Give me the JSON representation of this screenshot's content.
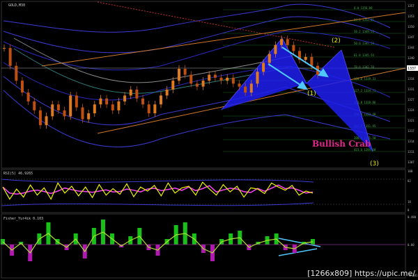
{
  "window": {
    "main_title": "GOLD,M30",
    "rsi_title": "RSI(5) 46.9265",
    "fisher_title": "Fisher_Yur4ik 0.103",
    "watermark": "[1266x809] https://upic.me/"
  },
  "pattern": {
    "label": "Bullish Crab",
    "wave_1": "(1)",
    "wave_2": "(2)",
    "wave_3": "(3)",
    "price_tag": "1337"
  },
  "price_axis": [
    "1357",
    "1353",
    "1350",
    "1347",
    "1344",
    "1340",
    "1337",
    "1334",
    "1331",
    "1327",
    "1324",
    "1321",
    "1317",
    "1314",
    "1311",
    "1307"
  ],
  "rsi_axis": [
    "100",
    "82",
    "18",
    "0"
  ],
  "fisher_axis": [
    "0.480",
    "0.00",
    "-0.481"
  ],
  "fib_levels": [
    "0.0 1356.00",
    "23.6 1352.01",
    "38.2 1349.53",
    "50.0 1347.54",
    "61.8 1345.54",
    "78.6 1342.70",
    "100.0 1339.31",
    "127.2 1334.71",
    "161.8 1328.86",
    "200.0 1322.40",
    "261.8 1311.95",
    "300.0 1305.50",
    "423.6 1284.60"
  ],
  "colors": {
    "background": "#000000",
    "candle_up": "#e07a1f",
    "candle_down": "#c05010",
    "envelope": "#3b3bd6",
    "pattern_fill": "#1f1ff0",
    "fib_lines": "#1d6b1d",
    "rsi_line": "#f2f200",
    "rsi_signal": "#ff40ff",
    "fisher_pos": "#19c019",
    "fisher_neg": "#b019b0",
    "arrow": "#4fc8ff",
    "label_pink": "#e0288a",
    "wave_yellow": "#ecec00"
  },
  "chart_data": {
    "type": "line",
    "title": "GOLD,M30",
    "series": [
      {
        "name": "GOLD,M30",
        "values": [
          1345,
          1339,
          1334,
          1330,
          1327,
          1324,
          1319,
          1322,
          1326,
          1324,
          1322,
          1329,
          1325,
          1321,
          1323,
          1326,
          1328,
          1326,
          1324,
          1327,
          1329,
          1331,
          1328,
          1326,
          1323,
          1326,
          1329,
          1331,
          1334,
          1338,
          1336,
          1333,
          1332,
          1334,
          1336,
          1335,
          1334,
          1335,
          1333,
          1332,
          1330,
          1333,
          1337,
          1340,
          1343,
          1346,
          1348,
          1346,
          1344,
          1341,
          1342,
          1339,
          1336
        ]
      },
      {
        "name": "RSI(5)",
        "values": [
          60,
          30,
          55,
          35,
          65,
          40,
          58,
          30,
          70,
          45,
          62,
          38,
          60,
          34,
          66,
          40,
          56,
          42,
          68,
          36,
          60,
          50,
          64,
          38,
          70,
          45,
          58,
          62,
          40,
          72,
          55,
          40,
          66,
          48,
          62,
          35,
          58,
          55,
          44,
          70,
          60,
          52,
          64,
          40,
          50,
          45
        ]
      },
      {
        "name": "Fisher_Yur4ik",
        "values": [
          0.1,
          -0.2,
          0.05,
          -0.3,
          0.2,
          0.4,
          0.1,
          -0.1,
          0.2,
          -0.25,
          0.3,
          0.45,
          0.2,
          -0.05,
          0.15,
          0.3,
          -0.1,
          -0.2,
          0.1,
          0.35,
          0.4,
          0.2,
          -0.15,
          -0.3,
          0.1,
          0.2,
          0.25,
          -0.1,
          0.05,
          0.15,
          0.2,
          -0.1,
          -0.15,
          0.05,
          0.1
        ]
      }
    ],
    "ylim": [
      1305,
      1360
    ]
  }
}
